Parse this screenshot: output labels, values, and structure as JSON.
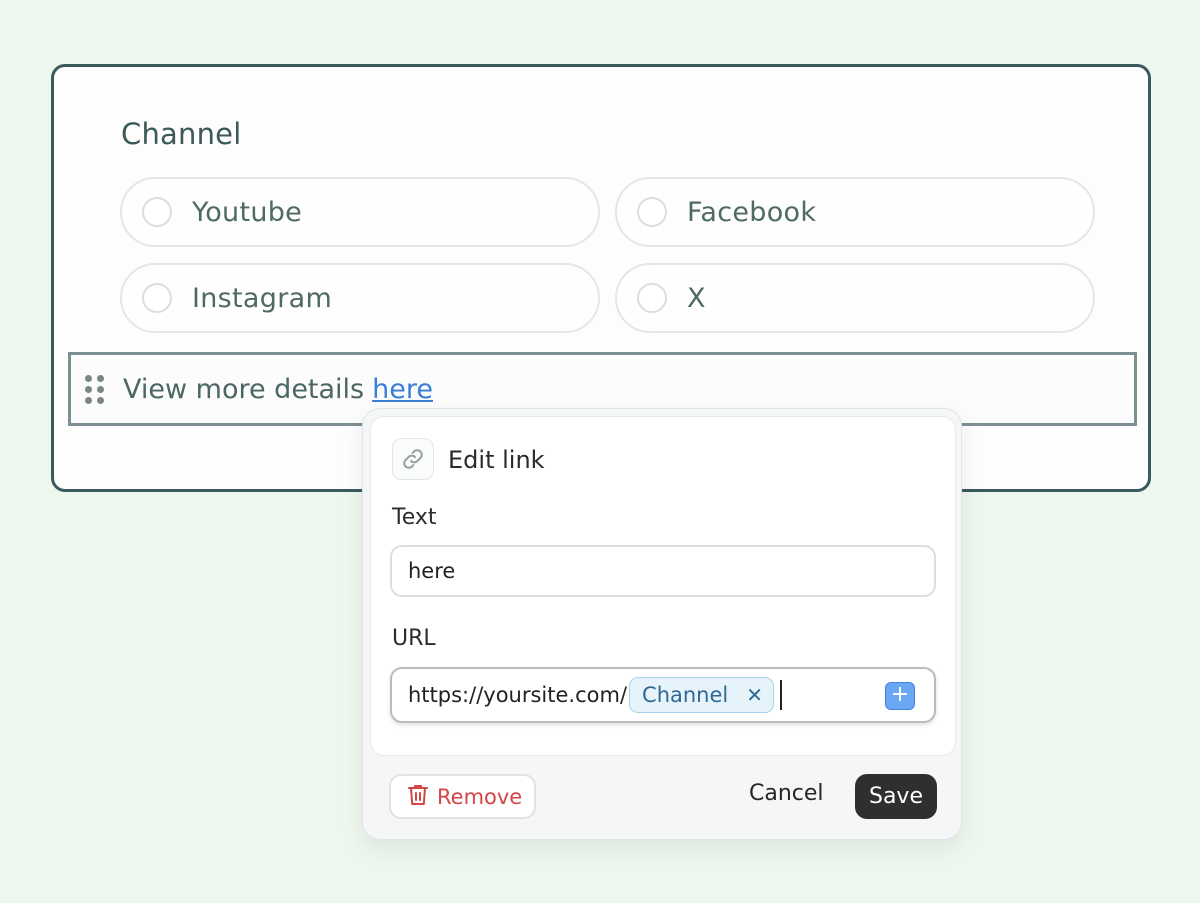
{
  "form": {
    "title": "Channel",
    "options": [
      {
        "label": "Youtube"
      },
      {
        "label": "Facebook"
      },
      {
        "label": "Instagram"
      },
      {
        "label": "X"
      }
    ],
    "detail_text": "View more details",
    "detail_link": "here"
  },
  "popover": {
    "title": "Edit link",
    "text_label": "Text",
    "text_value": "here",
    "url_label": "URL",
    "url_prefix": "https://yoursite.com/",
    "url_chip": "Channel",
    "chip_remove_icon": "close-icon",
    "add_icon": "plus-icon",
    "remove_label": "Remove",
    "cancel_label": "Cancel",
    "save_label": "Save"
  },
  "colors": {
    "accent": "#3a7fd6",
    "danger": "#d64545",
    "card_border": "#3a5a5f",
    "save_bg": "#2f2f2f"
  }
}
